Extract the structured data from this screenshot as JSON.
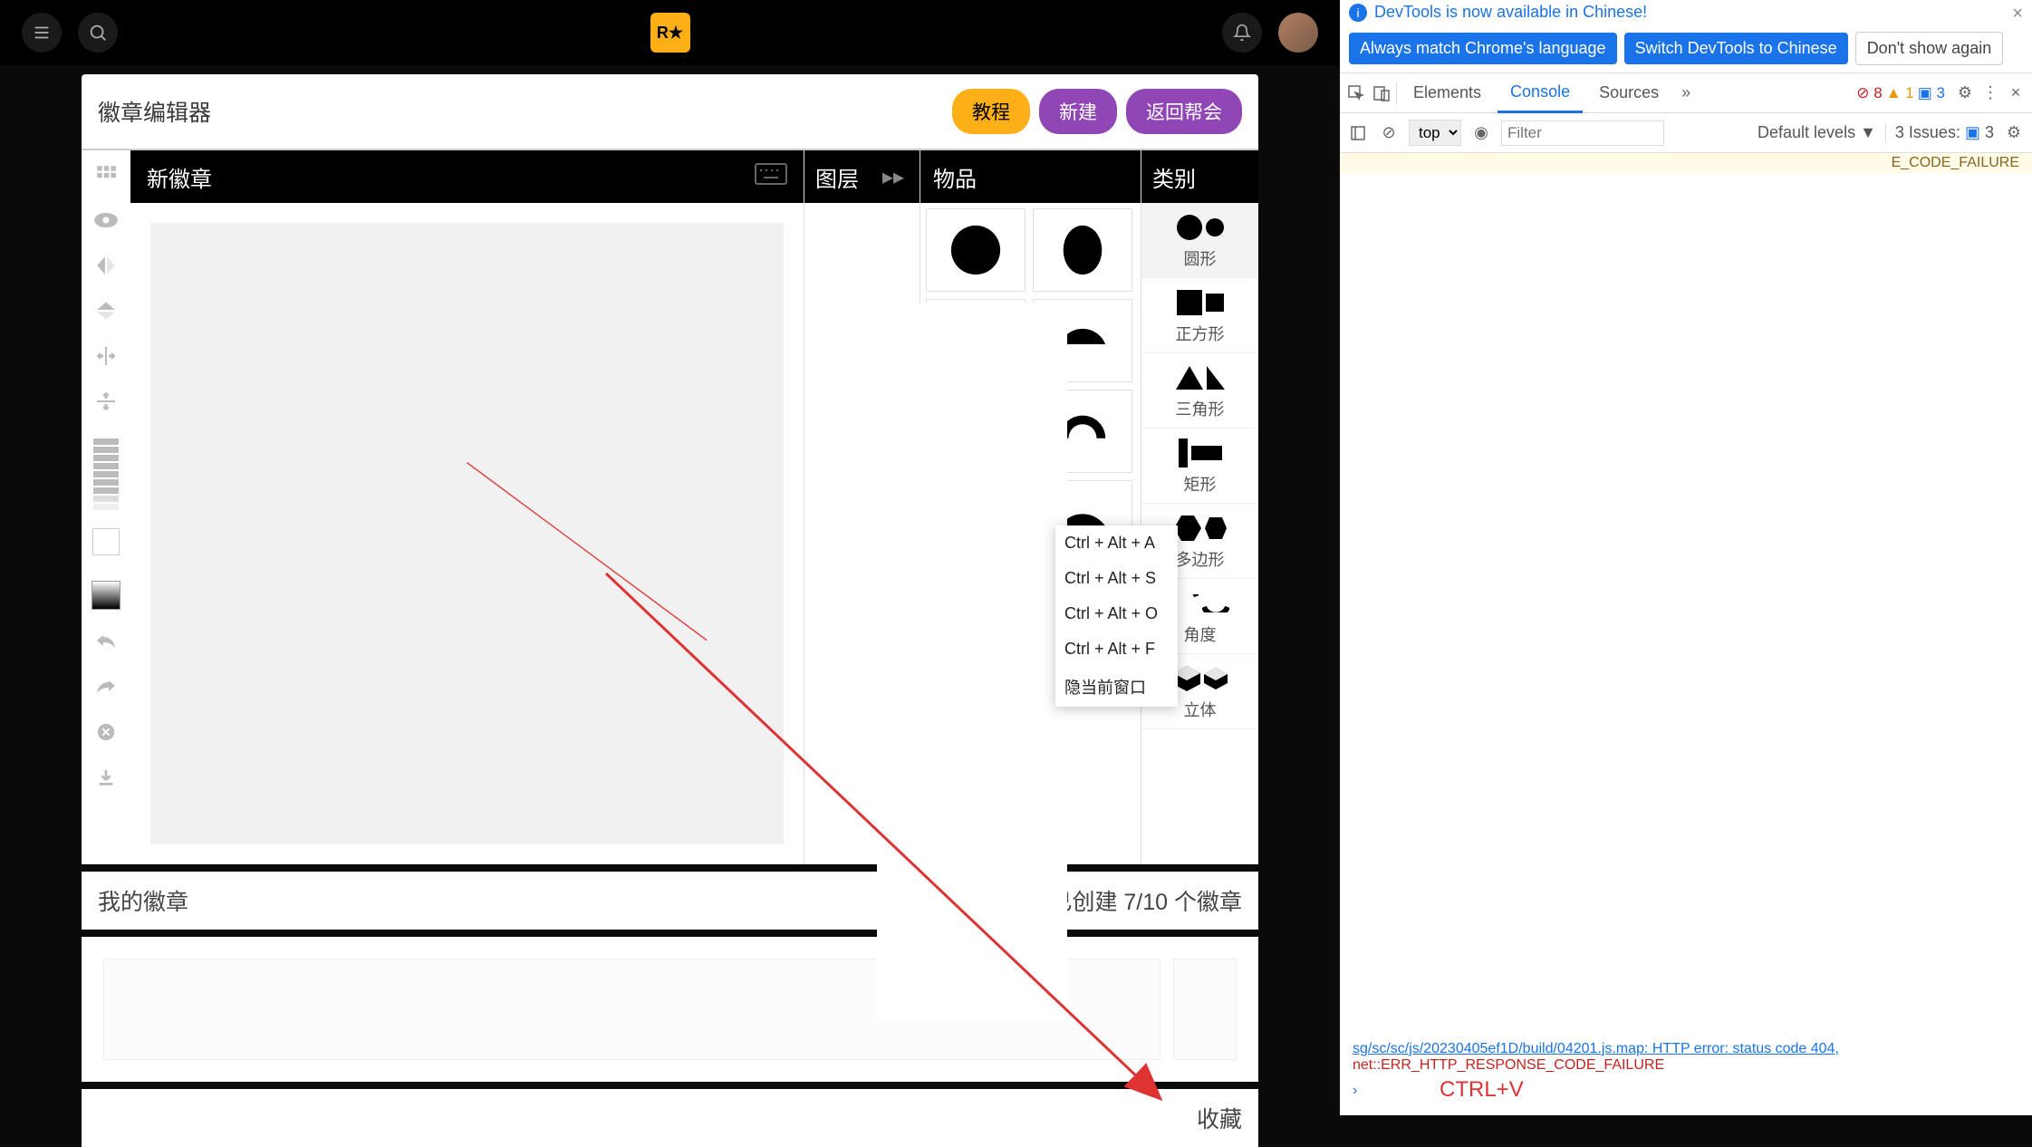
{
  "header": {
    "title": "徽章编辑器",
    "tutorial": "教程",
    "new": "新建",
    "back": "返回帮会"
  },
  "editor": {
    "new_emblem": "新徽章",
    "layers": "图层",
    "items": "物品",
    "categories": "类别"
  },
  "cats": [
    {
      "key": "circle",
      "label": "圆形"
    },
    {
      "key": "square",
      "label": "正方形"
    },
    {
      "key": "triangle",
      "label": "三角形"
    },
    {
      "key": "rect",
      "label": "矩形"
    },
    {
      "key": "polygon",
      "label": "多边形"
    },
    {
      "key": "angle",
      "label": "角度"
    },
    {
      "key": "solid",
      "label": "立体"
    }
  ],
  "popup": {
    "a": "Ctrl + Alt + A",
    "s": "Ctrl + Alt + S",
    "o": "Ctrl + Alt + O",
    "f": "Ctrl + Alt + F",
    "win": "隐当前窗口"
  },
  "bottom": {
    "my_emblems": "我的徽章",
    "created": "已创建 7/10 个徽章",
    "favorites": "收藏"
  },
  "devtools": {
    "info": "DevTools is now available in Chinese!",
    "always_match": "Always match Chrome's language",
    "switch_cn": "Switch DevTools to Chinese",
    "dont_show": "Don't show again",
    "tabs": {
      "elements": "Elements",
      "console": "Console",
      "sources": "Sources"
    },
    "top": "top",
    "filter_ph": "Filter",
    "default_levels": "Default levels",
    "issues": "3 Issues:",
    "err_count": "8",
    "warn_count": "1",
    "msg_count": "3",
    "issue_count": "3",
    "warn_tail": "E_CODE_FAILURE",
    "err1": "sg/sc/sc/js/20230405ef1D/build/04201.js.map: HTTP error: status code 404,",
    "err2": "net::ERR_HTTP_RESPONSE_CODE_FAILURE",
    "ctrlv": "CTRL+V"
  }
}
